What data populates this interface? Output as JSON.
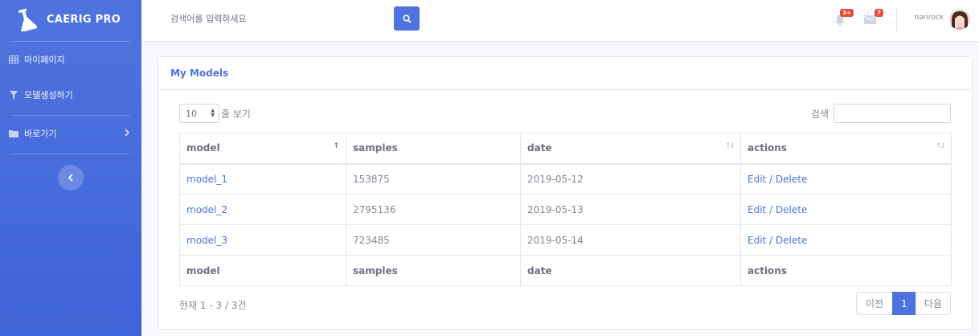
{
  "brand": {
    "name": "CAERIG PRO",
    "logo_icon": "flask-icon"
  },
  "sidebar": {
    "items": [
      {
        "label": "마이페이지",
        "icon": "table-icon"
      },
      {
        "label": "모델생성하기",
        "icon": "filter-icon"
      },
      {
        "label": "바로가기",
        "icon": "folder-icon"
      }
    ]
  },
  "topbar": {
    "search_placeholder": "검색어를 입력하세요",
    "alerts_count": "3+",
    "messages_count": "7",
    "username": "narirock"
  },
  "card": {
    "title": "My Models"
  },
  "table_controls": {
    "length_value": "10",
    "length_suffix": "줄 보기",
    "search_label": "검색"
  },
  "table": {
    "columns": [
      "model",
      "samples",
      "date",
      "actions"
    ],
    "rows": [
      {
        "model": "model_1",
        "samples": "153875",
        "date": "2019-05-12"
      },
      {
        "model": "model_2",
        "samples": "2795136",
        "date": "2019-05-13"
      },
      {
        "model": "model_3",
        "samples": "723485",
        "date": "2019-05-14"
      }
    ],
    "edit_label": "Edit",
    "action_sep": " / ",
    "delete_label": "Delete"
  },
  "footer": {
    "info": "현재 1 - 3 / 3건",
    "prev": "이전",
    "current_page": "1",
    "next": "다음"
  },
  "colors": {
    "primary": "#4e73df",
    "badge": "#e74a3b"
  }
}
